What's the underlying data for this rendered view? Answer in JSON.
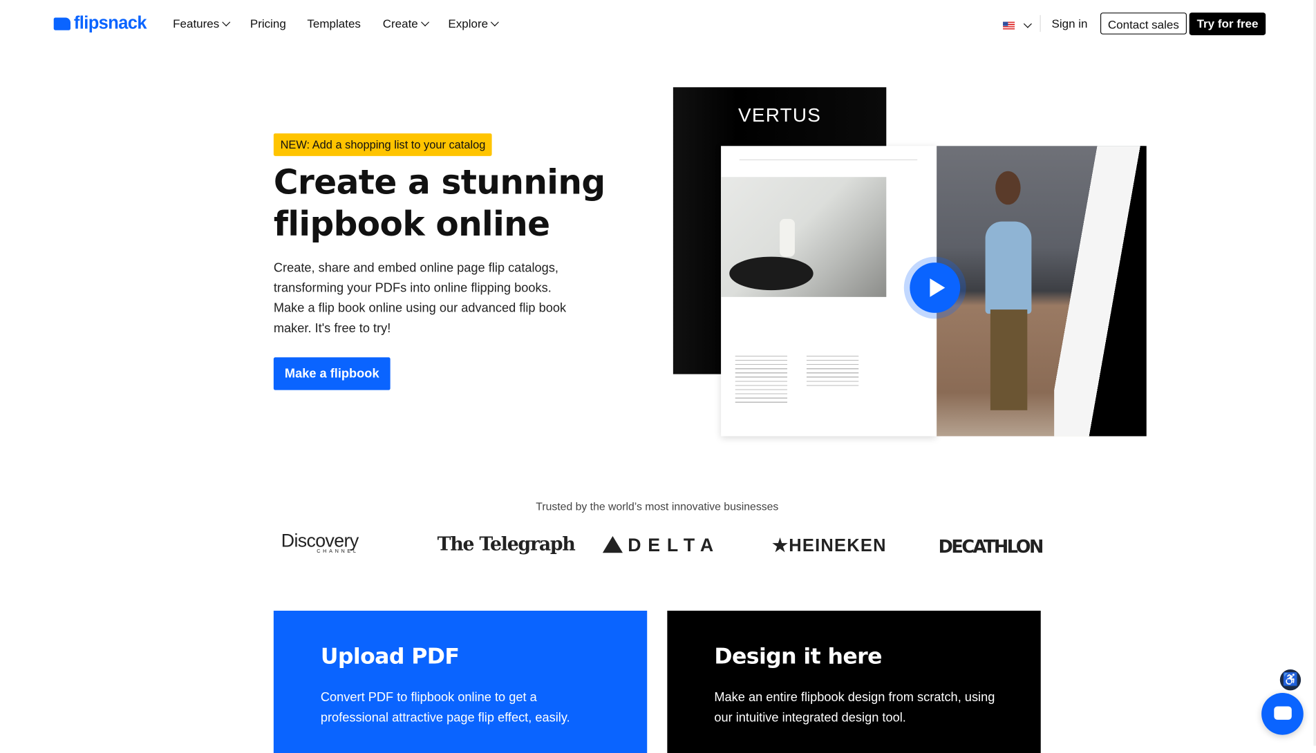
{
  "header": {
    "logo": "flipsnack",
    "nav": [
      {
        "label": "Features",
        "dropdown": true
      },
      {
        "label": "Pricing",
        "dropdown": false
      },
      {
        "label": "Templates",
        "dropdown": false
      },
      {
        "label": "Create",
        "dropdown": true
      },
      {
        "label": "Explore",
        "dropdown": true
      }
    ],
    "language_icon": "us-flag-icon",
    "sign_in": "Sign in",
    "contact_sales": "Contact sales",
    "try_free": "Try for free"
  },
  "hero": {
    "badge": "NEW: Add a shopping list to your catalog",
    "title_line1": "Create a stunning",
    "title_line2": "flipbook online",
    "description": "Create, share and embed online page flip catalogs, transforming your PDFs into online flipping books. Make a flip book online using our advanced flip book maker. It's free to try!",
    "cta": "Make a flipbook",
    "preview": {
      "cover_brand": "VERTUS",
      "play_icon": "play-icon"
    }
  },
  "trusted": {
    "text": "Trusted by the world’s most innovative businesses",
    "logos": [
      "Discovery",
      "CHANNEL",
      "The Telegraph",
      "DELTA",
      "HEINEKEN",
      "DECATHLON"
    ]
  },
  "cards": [
    {
      "title": "Upload PDF",
      "text": "Convert PDF to flipbook online to get a professional attractive page flip effect, easily.",
      "color": "#0a64ff"
    },
    {
      "title": "Design it here",
      "text": "Make an entire flipbook design from scratch, using our intuitive integrated design tool.",
      "color": "#000000"
    }
  ],
  "colors": {
    "brand": "#0a64ff",
    "badge": "#ffc400"
  }
}
